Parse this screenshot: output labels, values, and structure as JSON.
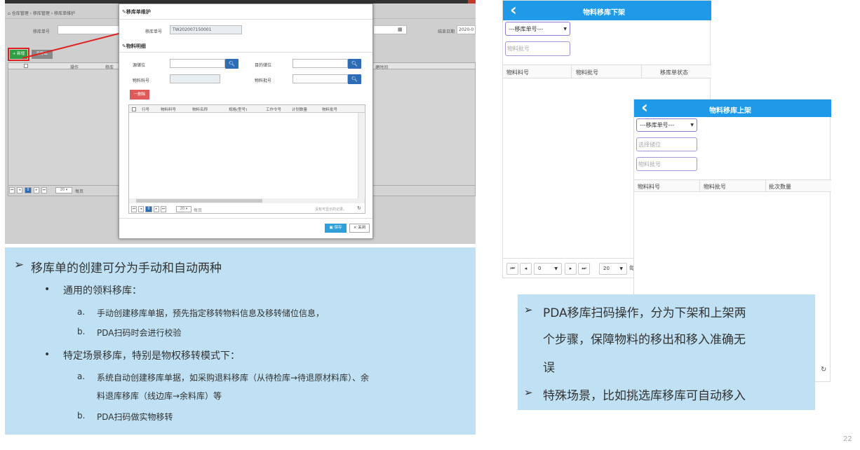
{
  "left_screen": {
    "breadcrumb": "⌂ 仓库管理 › 移库管理 › 移库单维护",
    "filter_label": "移库单号",
    "end_date_label": "结束日期",
    "end_date_value": "2020-0",
    "add_button": "+ 新增",
    "export_button": "导出",
    "col_operation": "操作",
    "col_moveno": "移库",
    "col_time": "建时间",
    "pager_page": "0",
    "pager_size": "20",
    "pager_per": "每页"
  },
  "modal": {
    "title": "移库单维护",
    "order_label": "移库单号",
    "order_value": "TW202007150001",
    "detail_title": "物料明细",
    "src_loc_label": "源储位",
    "dst_loc_label": "目的储位",
    "material_label": "物料料号",
    "batch_label": "物料批号",
    "delete_button": "一删除",
    "columns": [
      "行号",
      "物料料号",
      "物料名称",
      "规格(型号)",
      "工作令号",
      "计划数量",
      "物料批号"
    ],
    "pager_page": "0",
    "pager_size": "20",
    "pager_per": "每页",
    "no_records": "没有可显示的记录。",
    "save_button": "保存",
    "close_button": "× 关闭"
  },
  "left_notes": {
    "b1": "移库单的创建可分为手动和自动两种",
    "b1_1": "通用的领料移库：",
    "b1_1_a": "手动创建移库单据，预先指定移转物料信息及移转储位信息，",
    "b1_1_b": "PDA扫码时会进行校验",
    "b1_2": "特定场景移库，特别是物权移转模式下：",
    "b1_2_a1": "系统自动创建移库单据，如采购退料移库（从待检库→待退原材料库）、余",
    "b1_2_a2": "料退库移库（线边库→余料库）等",
    "b1_2_b": "PDA扫码做实物移转",
    "marker_a": "a.",
    "marker_b": "b."
  },
  "pda_down": {
    "back": "‹",
    "title": "物料移库下架",
    "order_select": "---移库单号---",
    "batch_placeholder": "物料批号",
    "col1": "物料料号",
    "col2": "物料批号",
    "col3": "移库单状态",
    "page": "0",
    "size": "20",
    "per": "每"
  },
  "pda_up": {
    "back": "‹",
    "title": "物料移库上架",
    "order_select": "---移库单号---",
    "loc_placeholder": "选择储位",
    "batch_placeholder": "物料批号",
    "col1": "物料料号",
    "col2": "物料批号",
    "col3": "批次数量"
  },
  "right_notes": {
    "b1_l1": "PDA移库扫码操作，分为下架和上架两",
    "b1_l2": "个步骤，保障物料的移出和移入准确无",
    "b1_l3": "误",
    "b2": "特殊场景，比如挑选库移库可自动移入"
  },
  "page_number": "22",
  "colors": {
    "accent_blue": "#1e9ae8",
    "panel": "#bfe1f3",
    "arrow_red": "#e02020"
  }
}
